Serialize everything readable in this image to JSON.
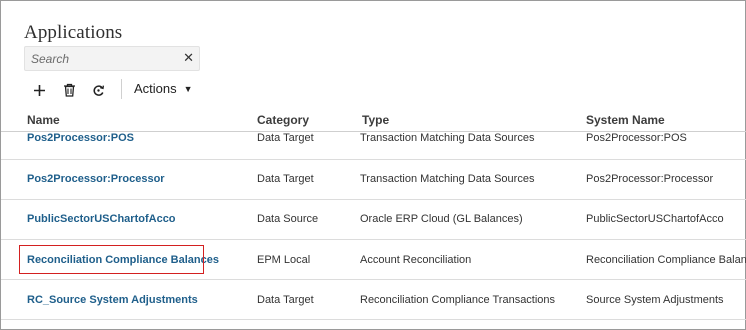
{
  "page": {
    "title": "Applications"
  },
  "search": {
    "placeholder": "Search",
    "value": "",
    "clear_icon": "close-icon"
  },
  "toolbar": {
    "add_icon": "plus-icon",
    "delete_icon": "trash-icon",
    "refresh_icon": "refresh-icon",
    "actions_label": "Actions"
  },
  "table": {
    "columns": [
      "Name",
      "Category",
      "Type",
      "System Name"
    ],
    "rows": [
      {
        "name": "Pos2Processor:POS",
        "category": "Data Target",
        "type": "Transaction Matching Data Sources",
        "system_name": "Pos2Processor:POS"
      },
      {
        "name": "Pos2Processor:Processor",
        "category": "Data Target",
        "type": "Transaction Matching Data Sources",
        "system_name": "Pos2Processor:Processor"
      },
      {
        "name": "PublicSectorUSChartofAcco",
        "category": "Data Source",
        "type": "Oracle ERP Cloud (GL Balances)",
        "system_name": "PublicSectorUSChartofAcco"
      },
      {
        "name": "Reconciliation Compliance Balances",
        "category": "EPM Local",
        "type": "Account Reconciliation",
        "system_name": "Reconciliation Compliance Balances"
      },
      {
        "name": "RC_Source System Adjustments",
        "category": "Data Target",
        "type": "Reconciliation Compliance Transactions",
        "system_name": "Source System Adjustments"
      }
    ]
  },
  "colors": {
    "link": "#1f5f8b",
    "highlight": "#d32020"
  }
}
